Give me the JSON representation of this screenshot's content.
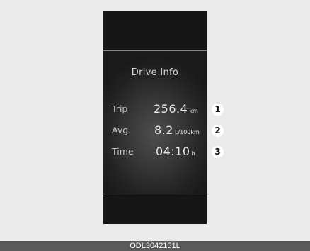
{
  "display": {
    "title": "Drive Info",
    "rows": [
      {
        "label": "Trip",
        "value": "256.4",
        "unit": "km",
        "marker": "1"
      },
      {
        "label": "Avg.",
        "value": "8.2",
        "unit": "L/100km",
        "marker": "2"
      },
      {
        "label": "Time",
        "value": "04:10",
        "unit": "h",
        "marker": "3"
      }
    ]
  },
  "caption": "ODL3042151L",
  "colors": {
    "background": "#ebebeb",
    "panel": "#161616",
    "text": "#e8e8e8",
    "caption_bar": "#5a5a5a"
  }
}
